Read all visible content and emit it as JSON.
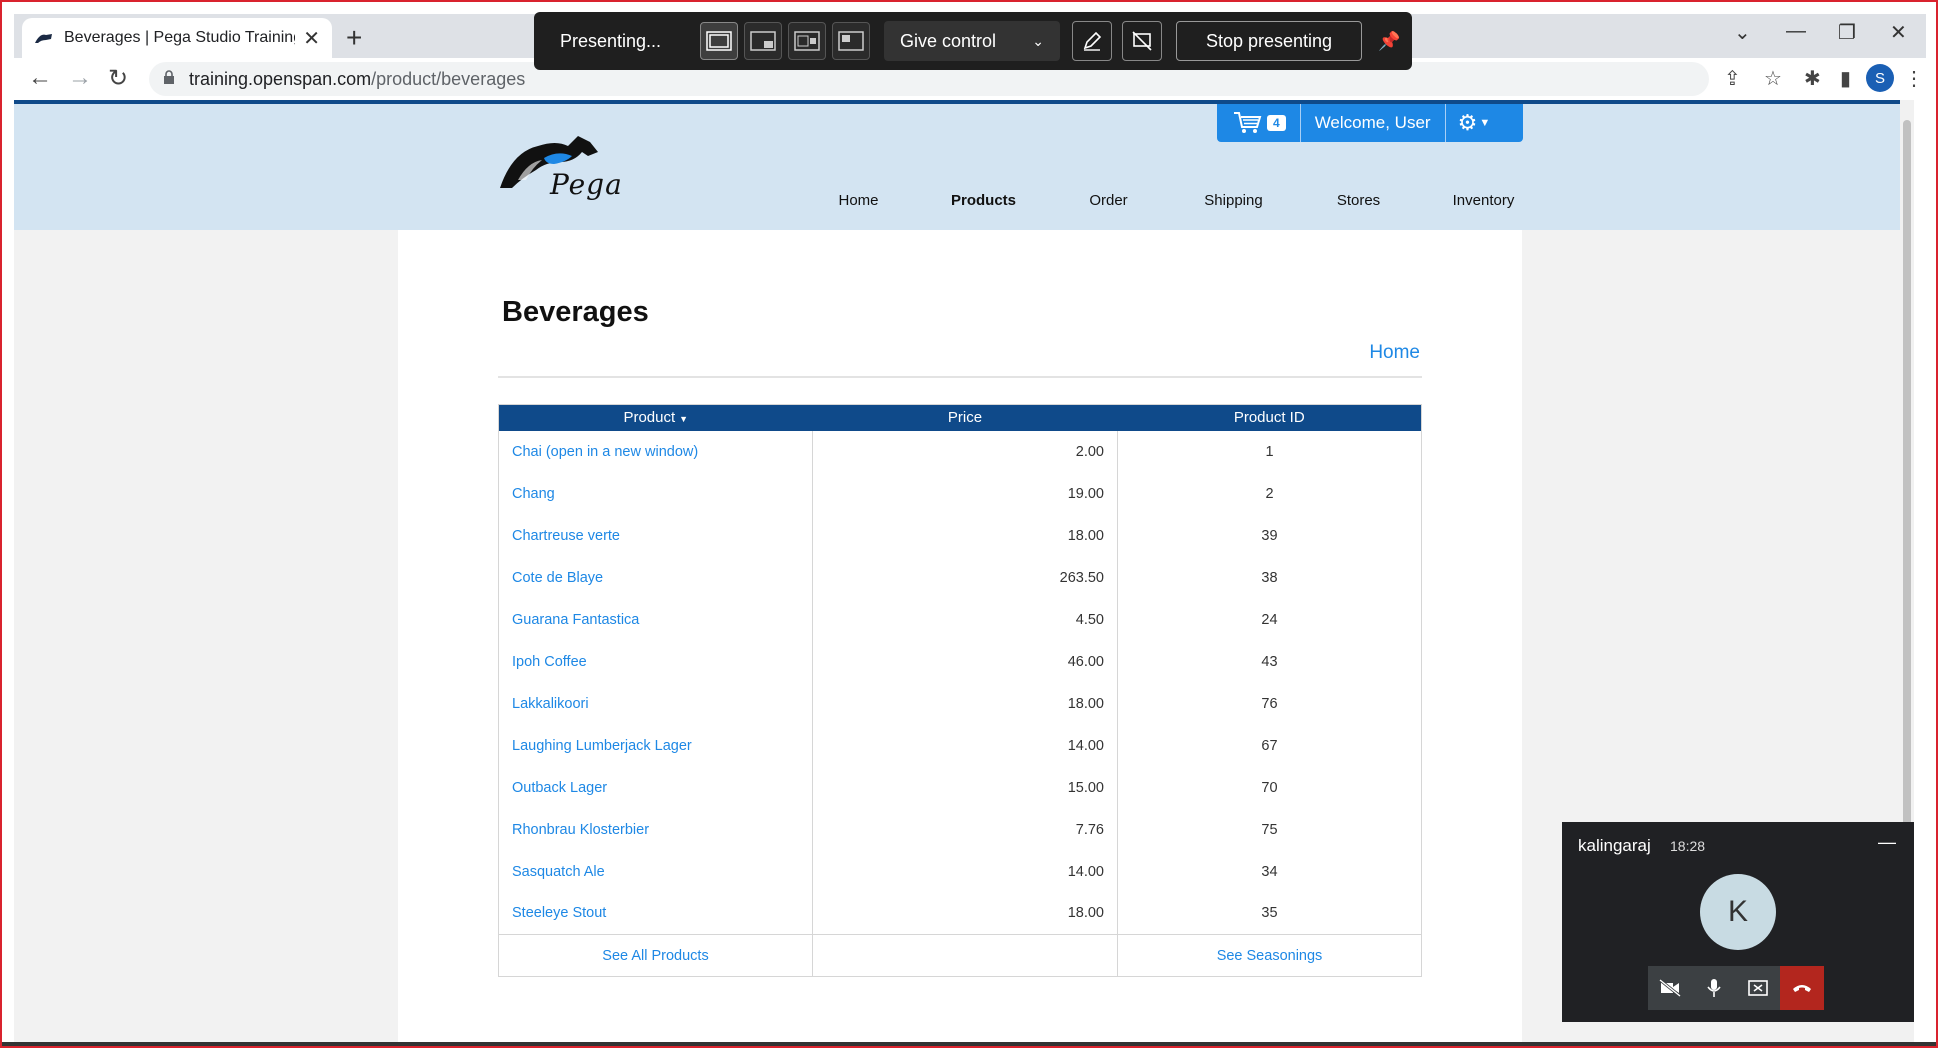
{
  "browser": {
    "tab_title": "Beverages | Pega Studio Training",
    "url_domain": "training.openspan.com",
    "url_path": "/product/beverages",
    "profile_initial": "S"
  },
  "presenting": {
    "status": "Presenting...",
    "give_control": "Give control",
    "stop": "Stop presenting"
  },
  "site": {
    "logo_text": "Pega",
    "cart_count": "4",
    "welcome": "Welcome, User",
    "nav": [
      "Home",
      "Products",
      "Order",
      "Shipping",
      "Stores",
      "Inventory"
    ],
    "active_nav": "Products"
  },
  "page": {
    "title": "Beverages",
    "home_link": "Home",
    "columns": [
      "Product",
      "Price",
      "Product ID"
    ],
    "rows": [
      {
        "product": "Chai  (open in a new window)",
        "price": "2.00",
        "id": "1"
      },
      {
        "product": "Chang",
        "price": "19.00",
        "id": "2"
      },
      {
        "product": "Chartreuse verte",
        "price": "18.00",
        "id": "39"
      },
      {
        "product": "Cote de Blaye",
        "price": "263.50",
        "id": "38"
      },
      {
        "product": "Guarana Fantastica",
        "price": "4.50",
        "id": "24"
      },
      {
        "product": "Ipoh Coffee",
        "price": "46.00",
        "id": "43"
      },
      {
        "product": "Lakkalikoori",
        "price": "18.00",
        "id": "76"
      },
      {
        "product": "Laughing Lumberjack Lager",
        "price": "14.00",
        "id": "67"
      },
      {
        "product": "Outback Lager",
        "price": "15.00",
        "id": "70"
      },
      {
        "product": "Rhonbrau Klosterbier",
        "price": "7.76",
        "id": "75"
      },
      {
        "product": "Sasquatch Ale",
        "price": "14.00",
        "id": "34"
      },
      {
        "product": "Steeleye Stout",
        "price": "18.00",
        "id": "35"
      }
    ],
    "footer_left": "See All Products",
    "footer_right": "See Seasonings"
  },
  "call": {
    "name": "kalingaraj",
    "time": "18:28",
    "avatar_initial": "K"
  },
  "colors": {
    "accent": "#1e88e5",
    "table_header": "#0f4a8a",
    "header_bg": "#d3e4f2"
  }
}
